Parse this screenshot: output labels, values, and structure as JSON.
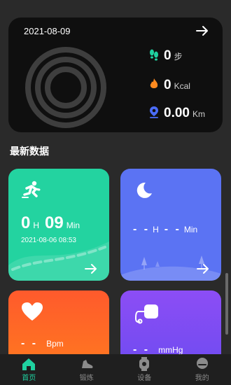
{
  "summary": {
    "date": "2021-08-09",
    "steps": {
      "value": "0",
      "unit": "步"
    },
    "calories": {
      "value": "0",
      "unit": "Kcal"
    },
    "distance": {
      "value": "0.00",
      "unit": "Km"
    }
  },
  "section_title": "最新数据",
  "cards": {
    "exercise": {
      "hours": "0",
      "hours_unit": "H",
      "minutes": "09",
      "minutes_unit": "Min",
      "timestamp": "2021-08-06 08:53",
      "color": "#23d3a0"
    },
    "sleep": {
      "hours": "- -",
      "hours_unit": "H",
      "minutes": "- -",
      "minutes_unit": "Min",
      "color": "#5b73f3"
    },
    "heart_rate": {
      "value": "- -",
      "unit": "Bpm",
      "color": "#ff5a2c"
    },
    "blood_pressure": {
      "value": "- -",
      "unit": "mmHg",
      "color": "#8c4df5"
    }
  },
  "nav": {
    "items": [
      {
        "label": "首页",
        "icon": "home-icon",
        "active": true
      },
      {
        "label": "锻炼",
        "icon": "shoe-icon",
        "active": false
      },
      {
        "label": "设备",
        "icon": "watch-icon",
        "active": false
      },
      {
        "label": "我的",
        "icon": "profile-icon",
        "active": false
      }
    ]
  }
}
